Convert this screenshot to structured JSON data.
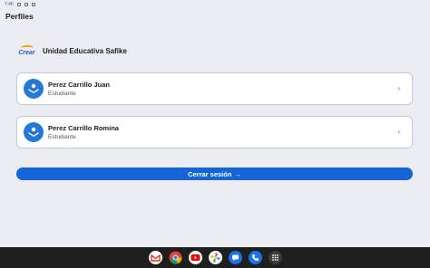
{
  "status_bar": {
    "time": "7:46"
  },
  "page_title": "Perfiles",
  "school": {
    "logo_text": "Crear",
    "name": "Unidad Educativa Safike"
  },
  "profiles": [
    {
      "name": "Perez Carrillo Juan",
      "role": "Estudiante"
    },
    {
      "name": "Perez Carrillo Romina",
      "role": "Estudiante"
    }
  ],
  "logout": {
    "label": "Cerrar sesión",
    "arrow": "→"
  },
  "chevron": "›",
  "taskbar": {
    "apps": [
      "gmail-icon",
      "chrome-icon",
      "youtube-icon",
      "photos-icon",
      "messages-icon",
      "phone-icon",
      "app-drawer-icon"
    ]
  },
  "colors": {
    "accent": "#1466d8",
    "avatar": "#2478d8",
    "background": "#ecedf2"
  }
}
